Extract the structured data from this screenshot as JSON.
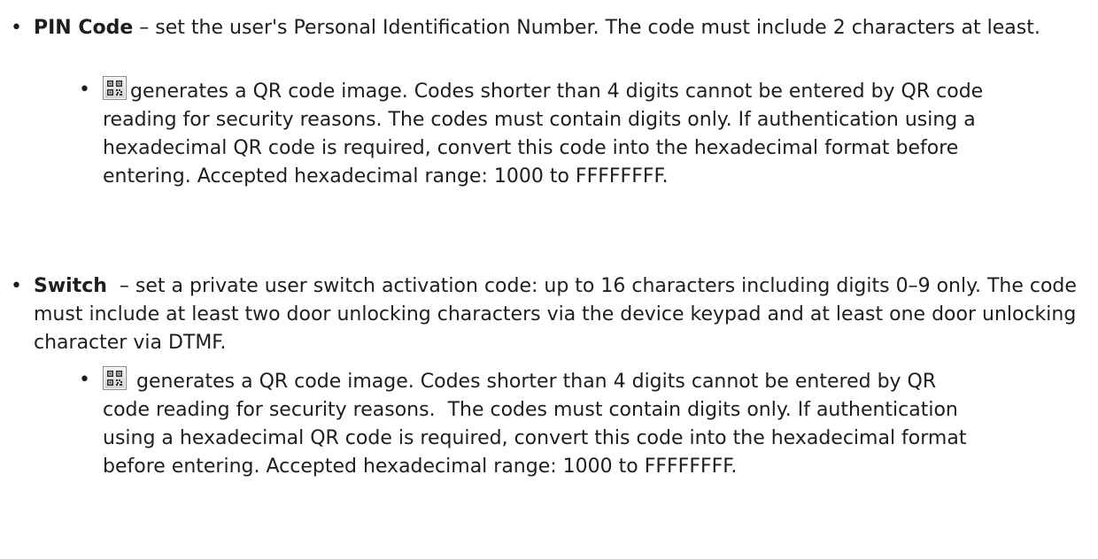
{
  "pin_code": {
    "term": "PIN Code",
    "description": " – set the user's Personal Identification Number. The code must include 2 characters at least.",
    "qr_note": "generates a QR code image. Codes shorter than 4 digits cannot be entered by QR code reading for security reasons.  The codes must contain digits only. If authentication using a hexadecimal QR code is required, convert this code into the hexadecimal format before entering. Accepted hexadecimal range: 1000 to FFFFFFFF."
  },
  "switch": {
    "term": "Switch",
    "description": "  – set a private user switch activation code: up to 16 characters including digits 0–9 only. The code must include at least two door unlocking characters via the device keypad and at least one door unlocking character via DTMF.",
    "qr_note": " generates a QR code image. Codes shorter than 4 digits cannot be entered by QR code reading for security reasons.  The codes must contain digits only. If authentication using a hexadecimal QR code is required, convert this code into the hexadecimal format before entering. Accepted hexadecimal range: 1000 to FFFFFFFF."
  },
  "icons": {
    "qr_button": "qr-code-icon"
  }
}
